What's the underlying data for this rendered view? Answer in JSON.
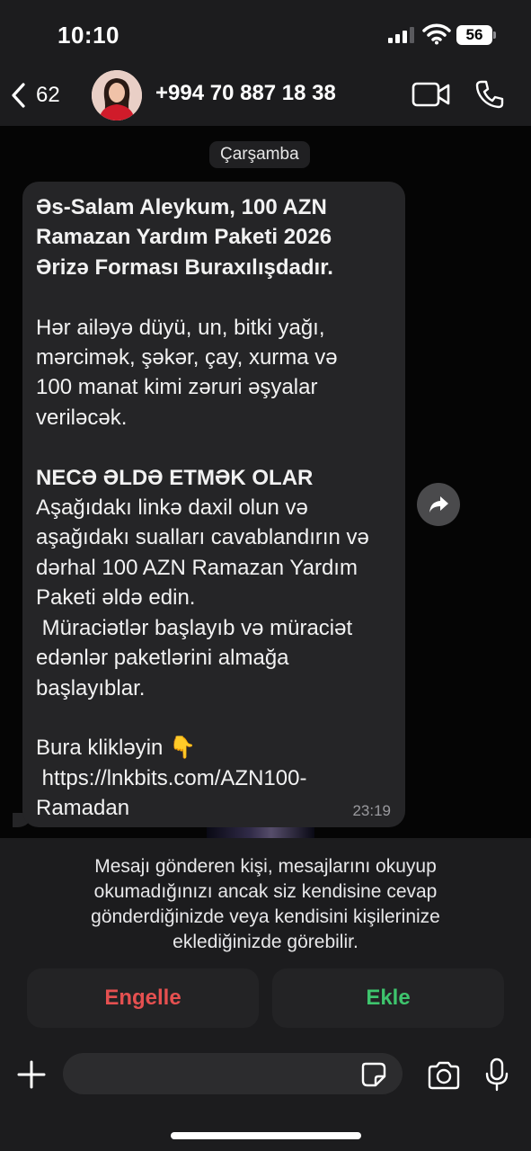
{
  "status_bar": {
    "time": "10:10",
    "battery": "56"
  },
  "header": {
    "back_count": "62",
    "contact": "+994 70 887 18 38"
  },
  "chat": {
    "day_label": "Çarşamba",
    "message": {
      "heading": "Əs-Salam Aleykum, 100 AZN\nRamazan Yardım Paketi 2026\nƏrizə Forması Buraxılışdadır.",
      "body1": "Hər ailəyə düyü, un, bitki yağı,\nmərcimək, şəkər, çay, xurma və\n100 manat kimi zəruri əşyalar\nveriləcək.",
      "subheading": "NECƏ ƏLDƏ ETMƏK OLAR",
      "body2": "Aşağıdakı linkə daxil olun və\naşağıdakı sualları cavablandırın və\ndərhal 100 AZN Ramazan Yardım\nPaketi əldə edin.\n Müraciətlər başlayıb və müraciət\nedənlər paketlərini almağa\nbaşlayıblar.",
      "cta": "Bura klikləyin 👇",
      "link": " https://lnkbits.com/AZN100-\nRamadan",
      "time": "23:19"
    }
  },
  "unknown_sender": {
    "notice": "Mesajı gönderen kişi, mesajlarını okuyup okumadığınızı ancak siz kendisine cevap gönderdiğinizde veya kendisini kişilerinize eklediğinizde görebilir.",
    "block_label": "Engelle",
    "add_label": "Ekle"
  },
  "composer": {
    "placeholder": ""
  },
  "colors": {
    "block": "#e55050",
    "add": "#3ec46d",
    "bubble": "#252527",
    "bar": "#1c1c1e"
  }
}
